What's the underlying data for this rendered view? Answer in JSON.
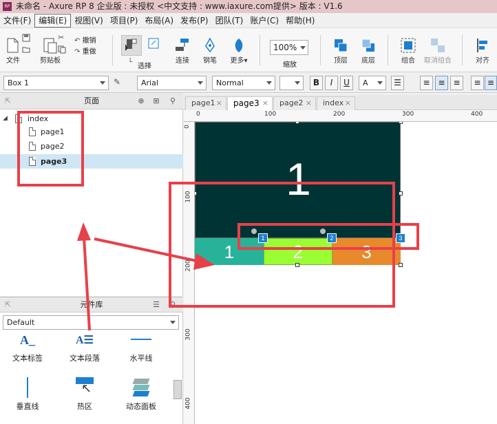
{
  "titlebar": {
    "text": "未命名 - Axure RP 8 企业版 : 未授权     <中文支持 : www.iaxure.com提供> 版本 : V1.6",
    "logo": "RP"
  },
  "menu": [
    "文件(F)",
    "编辑(E)",
    "视图(V)",
    "项目(P)",
    "布局(A)",
    "发布(P)",
    "团队(T)",
    "账户(C)",
    "帮助(H)"
  ],
  "toolbar": {
    "file": "文件",
    "clipboard": "剪贴板",
    "undo": "撤销",
    "redo": "重做",
    "select": "选择",
    "connect": "连接",
    "pen": "钢笔",
    "more": "更多▾",
    "zoom_value": "100%",
    "zoom": "缩放",
    "top": "顶层",
    "bottom": "底层",
    "group": "组合",
    "ungroup": "取消组合",
    "align": "对齐"
  },
  "formatbar": {
    "widget_name": "Box 1",
    "font": "Arial",
    "style": "Normal",
    "bold": "B",
    "italic": "I",
    "underline": "U",
    "font_color": "A"
  },
  "pages_panel": {
    "title": "页面",
    "root": "index",
    "pages": [
      "page1",
      "page2",
      "page3"
    ],
    "selected": "page3"
  },
  "library": {
    "title": "元件库",
    "dropdown": "Default",
    "items": [
      "文本标签",
      "文本段落",
      "水平线",
      "垂直线",
      "热区",
      "动态面板"
    ]
  },
  "tabs": [
    {
      "label": "page1",
      "close": "×"
    },
    {
      "label": "page3",
      "close": "×"
    },
    {
      "label": "page2",
      "close": "×"
    },
    {
      "label": "index",
      "close": "×"
    }
  ],
  "ruler": {
    "top": [
      "0",
      "100",
      "200",
      "300",
      "400"
    ],
    "left": [
      "0",
      "100",
      "200",
      "300",
      "400"
    ]
  },
  "canvas": {
    "main_panel_label": "1",
    "tab_labels": [
      "1",
      "2",
      "3"
    ],
    "badges": [
      "1",
      "2",
      "3"
    ],
    "colors": {
      "dark": "#003333",
      "teal": "#27b39a",
      "green": "#99ff33",
      "orange": "#e8892b",
      "red": "#e8404a",
      "badge": "#1e7fd0"
    }
  }
}
